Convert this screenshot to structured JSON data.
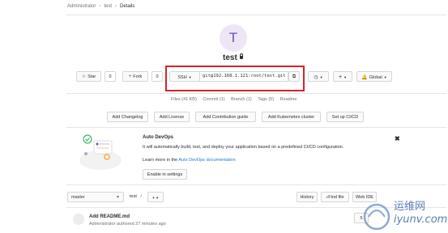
{
  "breadcrumb": {
    "items": [
      "Administrator",
      "test",
      "Details"
    ]
  },
  "project": {
    "avatar_letter": "T",
    "title": "test"
  },
  "actions": {
    "star_label": "Star",
    "star_count": "0",
    "fork_label": "Fork",
    "fork_count": "0",
    "clone_protocol": "SSH",
    "clone_url": "git@192.168.1.121:root/test.git",
    "global_label": "Global"
  },
  "stats": {
    "files": "Files (41 KB)",
    "commits": "Commit (1)",
    "branches": "Branch (1)",
    "tags": "Tags (0)",
    "readme": "Readme"
  },
  "suggestions": [
    "Add Changelog",
    "Add License",
    "Add Contribution guide",
    "Add Kubernetes cluster",
    "Set up CI/CD"
  ],
  "auto_devops": {
    "title": "Auto DevOps",
    "description": "It will automatically build, test, and deploy your application based on a predefined CI/CD configuration.",
    "learn_prefix": "Learn more in the",
    "learn_link": "Auto DevOps documentation",
    "enable_button": "Enable in settings"
  },
  "repo_toolbar": {
    "branch": "master",
    "path": "test",
    "path_sep": "/",
    "add_label": "+",
    "history": "History",
    "find_file": "Find file",
    "web_ide": "Web IDE"
  },
  "last_commit": {
    "title": "Add README.md",
    "meta": "Administrator authored 27 minutes ago",
    "sha_fragment": "5"
  },
  "watermark": {
    "chinese": "运维网",
    "latin": "iyunv.com"
  },
  "icons": [
    "star-icon",
    "fork-icon",
    "copy-icon",
    "notification-icon",
    "plus-icon",
    "globe-icon",
    "lock-icon",
    "close-icon"
  ]
}
